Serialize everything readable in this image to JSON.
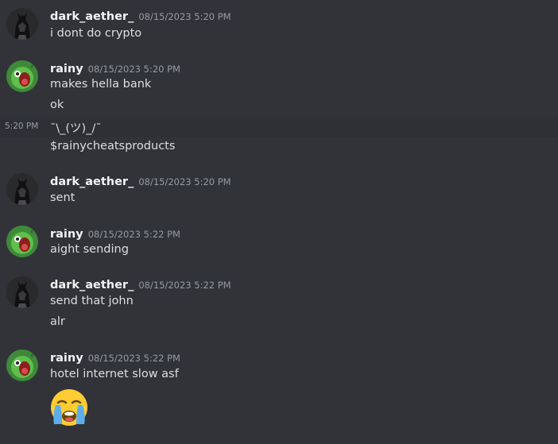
{
  "messages": [
    {
      "author": "dark_aether_",
      "timestamp": "08/15/2023 5:20 PM",
      "avatar": "dark-knight-avatar",
      "lines": [
        "i dont do crypto"
      ]
    },
    {
      "author": "rainy",
      "timestamp": "08/15/2023 5:20 PM",
      "avatar": "green-cartoon-avatar",
      "lines": [
        "makes hella bank",
        "ok",
        "¯\\_(ツ)_/¯",
        "$rainycheatsproducts"
      ],
      "hover_time": "5:20 PM"
    },
    {
      "author": "dark_aether_",
      "timestamp": "08/15/2023 5:20 PM",
      "avatar": "dark-knight-avatar",
      "lines": [
        "sent"
      ]
    },
    {
      "author": "rainy",
      "timestamp": "08/15/2023 5:22 PM",
      "avatar": "green-cartoon-avatar",
      "lines": [
        "aight sending"
      ]
    },
    {
      "author": "dark_aether_",
      "timestamp": "08/15/2023 5:22 PM",
      "avatar": "dark-knight-avatar",
      "lines": [
        "send that john",
        "alr"
      ]
    },
    {
      "author": "rainy",
      "timestamp": "08/15/2023 5:22 PM",
      "avatar": "green-cartoon-avatar",
      "lines": [
        "hotel internet slow asf"
      ],
      "emoji": "loudly-crying-face-emoji"
    }
  ],
  "colors": {
    "background": "#313338",
    "hover_row": "#2e3035",
    "username": "#f2f3f5",
    "timestamp": "#949ba4",
    "text": "#dbdee1"
  }
}
